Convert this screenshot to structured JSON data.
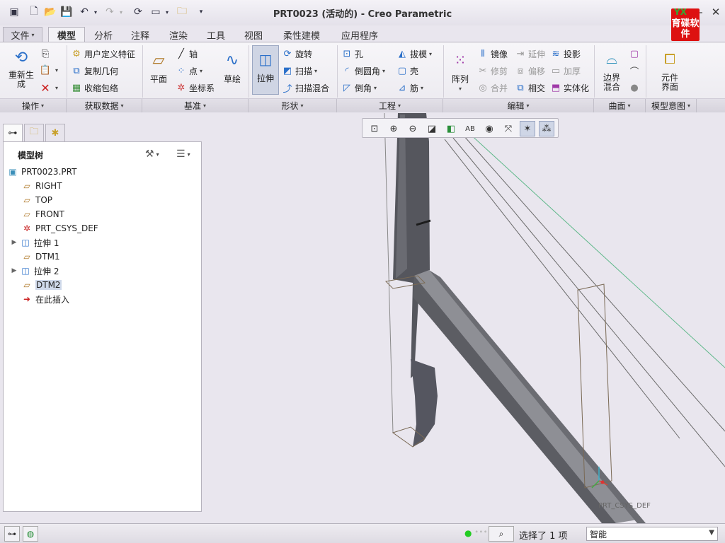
{
  "window": {
    "title": "PRT0023 (活动的) - Creo Parametric",
    "logo_text": "育碟软件"
  },
  "tabs": [
    {
      "label": "文件",
      "dropdown": "▾"
    },
    {
      "label": "模型"
    },
    {
      "label": "分析"
    },
    {
      "label": "注释"
    },
    {
      "label": "渲染"
    },
    {
      "label": "工具"
    },
    {
      "label": "视图"
    },
    {
      "label": "柔性建模"
    },
    {
      "label": "应用程序"
    }
  ],
  "ribbon": {
    "operations": {
      "regenerate": "重新生成",
      "group": "操作"
    },
    "get_data": {
      "user_feature": "用户定义特征",
      "copy_geometry": "复制几何",
      "shrinkwrap": "收缩包络",
      "group": "获取数据"
    },
    "datum": {
      "plane": "平面",
      "axis": "轴",
      "point": "点",
      "csys": "坐标系",
      "sketch": "草绘",
      "group": "基准"
    },
    "shapes": {
      "extrude": "拉伸",
      "revolve": "旋转",
      "sweep": "扫描",
      "swept_blend": "扫描混合",
      "group": "形状"
    },
    "engineering": {
      "hole": "孔",
      "round": "倒圆角",
      "chamfer": "倒角",
      "draft": "拔模",
      "shell": "壳",
      "rib": "筋",
      "group": "工程"
    },
    "editing": {
      "pattern": "阵列",
      "mirror": "镜像",
      "trim": "修剪",
      "merge": "合并",
      "extend": "延伸",
      "offset": "偏移",
      "intersect": "相交",
      "project": "投影",
      "thicken": "加厚",
      "solidify": "实体化",
      "group": "编辑"
    },
    "surfaces": {
      "boundary_blend": "边界混合",
      "group": "曲面"
    },
    "model_intent": {
      "component_interface": "元件界面",
      "group": "模型意图"
    }
  },
  "model_tree": {
    "title": "模型树",
    "items": [
      {
        "label": "PRT0023.PRT",
        "icon": "part-icon"
      },
      {
        "label": "RIGHT",
        "icon": "datum-plane-icon"
      },
      {
        "label": "TOP",
        "icon": "datum-plane-icon"
      },
      {
        "label": "FRONT",
        "icon": "datum-plane-icon"
      },
      {
        "label": "PRT_CSYS_DEF",
        "icon": "csys-icon"
      },
      {
        "label": "拉伸 1",
        "icon": "extrude-icon"
      },
      {
        "label": "DTM1",
        "icon": "datum-plane-icon"
      },
      {
        "label": "拉伸 2",
        "icon": "extrude-icon"
      },
      {
        "label": "DTM2",
        "icon": "datum-plane-icon"
      },
      {
        "label": "在此插入",
        "icon": "insert-here-arrow-icon"
      }
    ]
  },
  "graphics": {
    "csys_label": "PRT_CSYS_DEF"
  },
  "statusbar": {
    "message": "选择了 1 项",
    "filter_value": "智能"
  }
}
